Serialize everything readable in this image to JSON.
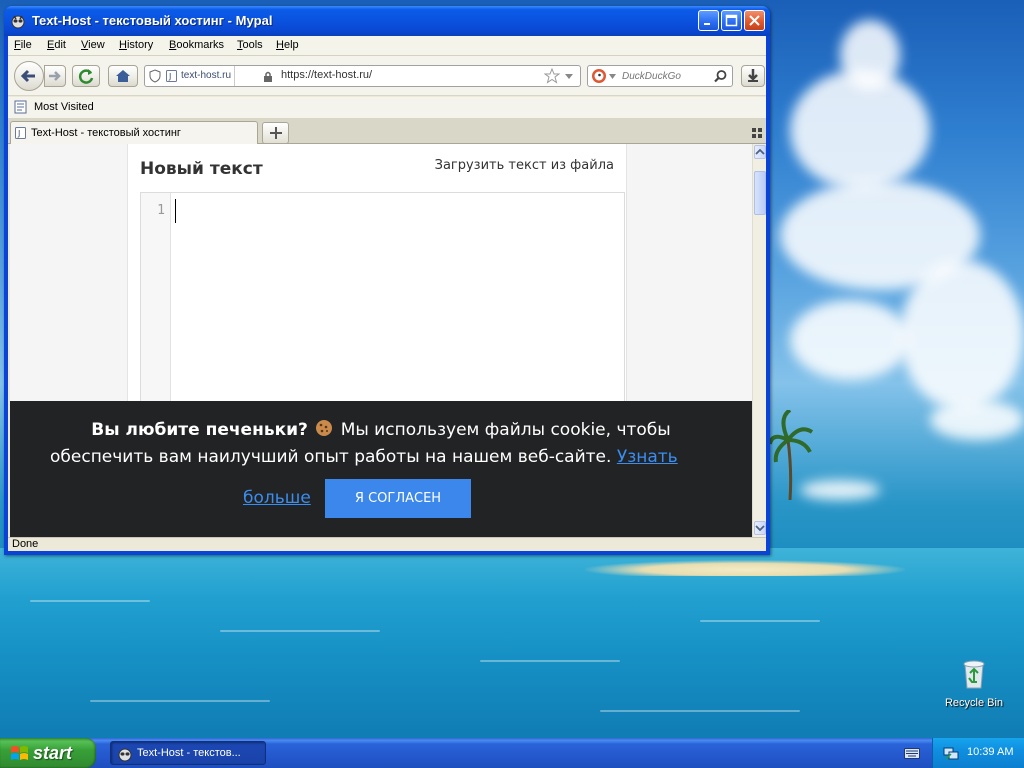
{
  "window": {
    "title": "Text-Host - текстовый хостинг - Mypal"
  },
  "menu": {
    "items": [
      {
        "label": "File",
        "underline": "F",
        "rest": "ile"
      },
      {
        "label": "Edit",
        "underline": "E",
        "rest": "dit"
      },
      {
        "label": "View",
        "underline": "V",
        "rest": "iew"
      },
      {
        "label": "History",
        "underline": "H",
        "rest": "istory"
      },
      {
        "label": "Bookmarks",
        "underline": "B",
        "rest": "ookmarks"
      },
      {
        "label": "Tools",
        "underline": "T",
        "rest": "ools"
      },
      {
        "label": "Help",
        "underline": "H",
        "rest": "elp"
      }
    ]
  },
  "nav": {
    "site_identity": "text-host.ru",
    "url": "https://text-host.ru/",
    "search_placeholder": "DuckDuckGo"
  },
  "bookmarks": {
    "most_visited": "Most Visited"
  },
  "tabs": [
    {
      "label": "Text-Host - текстовый хостинг",
      "active": true
    }
  ],
  "page": {
    "heading": "Новый текст",
    "upload_link": "Загрузить текст из файла",
    "line_number": "1"
  },
  "cookie_banner": {
    "question": "Вы любите печеньки?",
    "text_line1": "Мы используем файлы cookie, чтобы",
    "text_line2": "обеспечить вам наилучший опыт работы на нашем веб-сайте.",
    "learn_more_part1": "Узнать",
    "learn_more_part2": "больше",
    "agree_button": "Я СОГЛАСЕН"
  },
  "status": {
    "text": "Done"
  },
  "desktop": {
    "recycle_bin_label": "Recycle Bin"
  },
  "taskbar": {
    "start_label": "start",
    "task_label": "Text-Host - текстов...",
    "clock": "10:39 AM"
  },
  "colors": {
    "xp_blue": "#0a52df",
    "link_blue": "#3b8df0",
    "agree_button": "#3c87ec",
    "cookie_bg": "#222325",
    "start_green": "#38a038"
  }
}
